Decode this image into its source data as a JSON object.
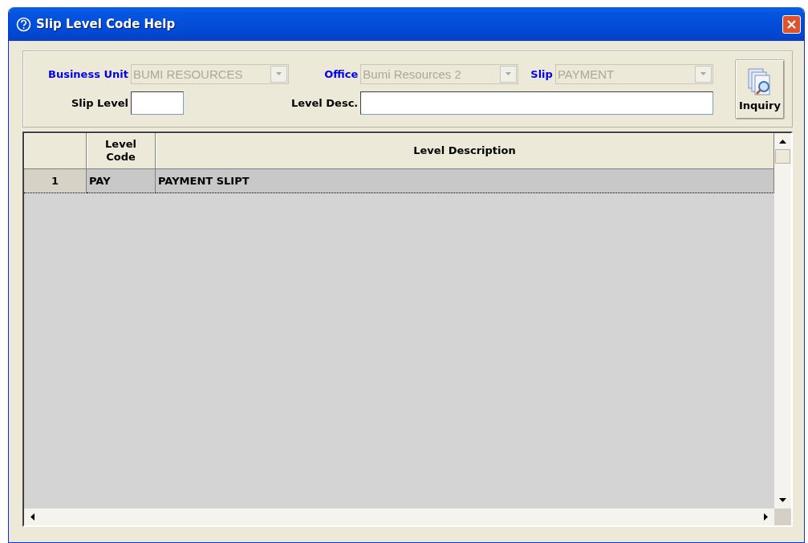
{
  "window": {
    "title": "Slip Level Code Help"
  },
  "filters": [
    {
      "label": "Business Unit",
      "value": "BUMI RESOURCES",
      "disabled": true
    },
    {
      "label": "Office",
      "value": "Bumi Resources 2",
      "disabled": true
    },
    {
      "label": "Slip",
      "value": "PAYMENT",
      "disabled": true
    }
  ],
  "fields": [
    {
      "label": "Slip Level"
    },
    {
      "label": "Level Desc."
    }
  ],
  "inquiry_button": {
    "label": "Inquiry"
  },
  "table": {
    "columns": [
      "Level Code",
      "Level Description"
    ],
    "rows": [
      {
        "number": "1",
        "code": "PAY",
        "description": "PAYMENT SLIPT",
        "selected": true
      }
    ]
  }
}
